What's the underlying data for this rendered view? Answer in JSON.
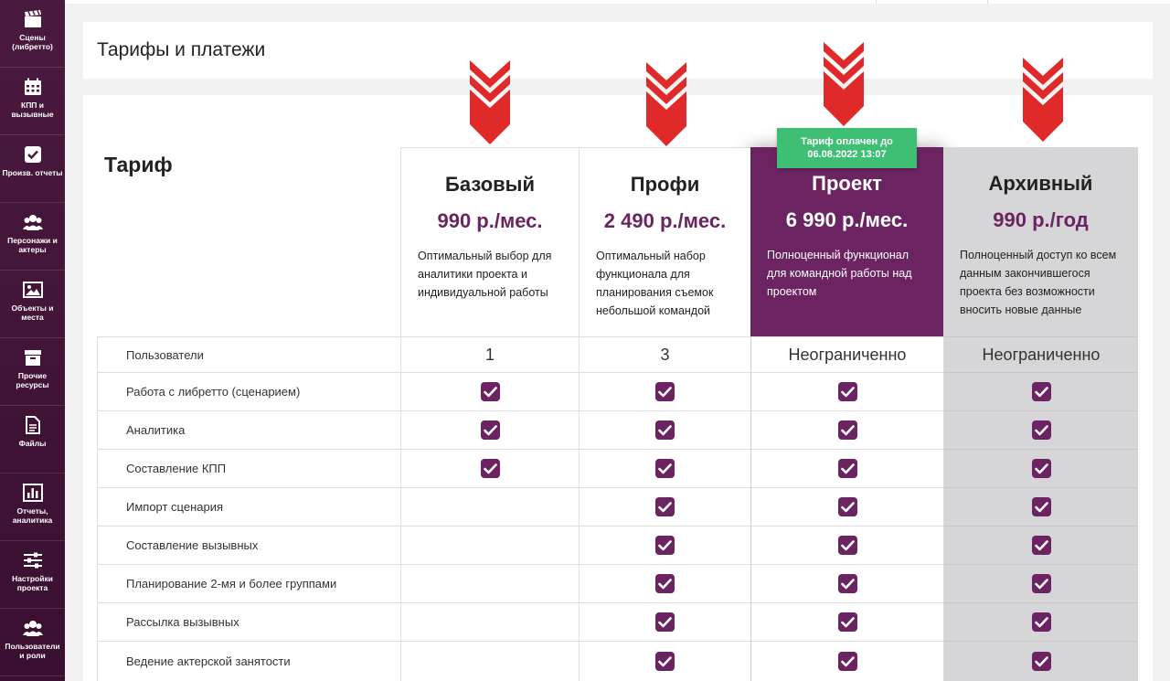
{
  "sidebar": {
    "items": [
      {
        "label": "Сцены (либретто)",
        "icon": "clapperboard-icon"
      },
      {
        "label": "КПП и вызывные",
        "icon": "calendar-icon"
      },
      {
        "label": "Произв. отчеты",
        "icon": "checkbox-icon"
      },
      {
        "label": "Персонажи и актеры",
        "icon": "people-icon"
      },
      {
        "label": "Объекты и места",
        "icon": "image-icon"
      },
      {
        "label": "Прочие ресурсы",
        "icon": "archive-box-icon"
      },
      {
        "label": "Файлы",
        "icon": "file-icon"
      },
      {
        "label": "Отчеты, аналитика",
        "icon": "bar-chart-icon"
      },
      {
        "label": "Настройки проекта",
        "icon": "sliders-icon"
      },
      {
        "label": "Пользователи и роли",
        "icon": "users-icon"
      }
    ]
  },
  "page": {
    "title": "Тарифы и платежи"
  },
  "table": {
    "header_label": "Тариф",
    "paid_badge": "Тариф оплачен до 06.08.2022 13:07",
    "plans": [
      {
        "name": "Базовый",
        "price": "990 р./мес.",
        "description": "Оптимальный выбор для аналитики проекта и индивидуальной работы"
      },
      {
        "name": "Профи",
        "price": "2 490 р./мес.",
        "description": "Оптимальный набор функционала для планирования съемок небольшой командой"
      },
      {
        "name": "Проект",
        "price": "6 990 р./мес.",
        "description": "Полноценный функционал для командной работы над проектом"
      },
      {
        "name": "Архивный",
        "price": "990 р./год",
        "description": "Полноценный доступ ко всем данным закончившегося проекта без возможности вносить новые данные"
      }
    ],
    "rows": [
      {
        "feature": "Пользователи",
        "values": [
          "1",
          "3",
          "Неограниченно",
          "Неограниченно"
        ]
      },
      {
        "feature": "Работа с либретто (сценарием)",
        "checks": [
          true,
          true,
          true,
          true
        ]
      },
      {
        "feature": "Аналитика",
        "checks": [
          true,
          true,
          true,
          true
        ]
      },
      {
        "feature": "Составление КПП",
        "checks": [
          true,
          true,
          true,
          true
        ]
      },
      {
        "feature": "Импорт сценария",
        "checks": [
          false,
          true,
          true,
          true
        ]
      },
      {
        "feature": "Составление вызывных",
        "checks": [
          false,
          true,
          true,
          true
        ]
      },
      {
        "feature": "Планирование 2-мя и более группами",
        "checks": [
          false,
          true,
          true,
          true
        ]
      },
      {
        "feature": "Рассылка вызывных",
        "checks": [
          false,
          true,
          true,
          true
        ]
      },
      {
        "feature": "Ведение актерской занятости",
        "checks": [
          false,
          true,
          true,
          true
        ]
      }
    ]
  },
  "colors": {
    "brand": "#6b2461",
    "badge": "#3fbf74",
    "arrow": "#e02a2a",
    "archive_bg": "#d6d6d8"
  }
}
